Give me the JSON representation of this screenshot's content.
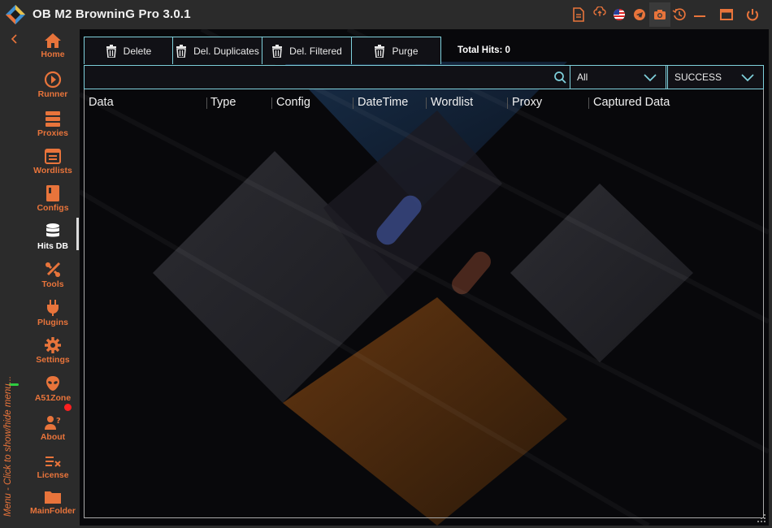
{
  "app": {
    "title": "OB M2 BrowninG Pro  3.0.1",
    "accent_color": "#e8743b",
    "border_color": "#7fd1dc"
  },
  "titlebar_icons": [
    "document-icon",
    "cloud-update-icon",
    "us-flag-icon",
    "telegram-icon",
    "camera-icon",
    "history-icon",
    "minimize-icon",
    "maximize-icon",
    "power-icon"
  ],
  "sidebar": {
    "hint": "Menu - Click to show/hide menu...",
    "items": [
      {
        "label": "Home",
        "icon": "home-icon"
      },
      {
        "label": "Runner",
        "icon": "play-circle-icon"
      },
      {
        "label": "Proxies",
        "icon": "server-icon"
      },
      {
        "label": "Wordlists",
        "icon": "calendar-list-icon"
      },
      {
        "label": "Configs",
        "icon": "notebook-icon"
      },
      {
        "label": "Hits DB",
        "icon": "database-icon",
        "active": true
      },
      {
        "label": "Tools",
        "icon": "tools-icon"
      },
      {
        "label": "Plugins",
        "icon": "plug-icon"
      },
      {
        "label": "Settings",
        "icon": "gear-icon"
      },
      {
        "label": "A51Zone",
        "icon": "alien-icon",
        "badge": "red-dot"
      },
      {
        "label": "About",
        "icon": "user-question-icon"
      },
      {
        "label": "License",
        "icon": "license-icon"
      },
      {
        "label": "MainFolder",
        "icon": "folder-icon"
      }
    ]
  },
  "toolbar": {
    "delete": "Delete",
    "del_duplicates": "Del. Duplicates",
    "del_filtered": "Del. Filtered",
    "purge": "Purge",
    "total_hits": "Total Hits: 0"
  },
  "filters": {
    "search_value": "",
    "type_selected": "All",
    "status_selected": "SUCCESS"
  },
  "table": {
    "columns": [
      "Data",
      "Type",
      "Config",
      "DateTime",
      "Wordlist",
      "Proxy",
      "Captured Data"
    ],
    "rows": []
  }
}
